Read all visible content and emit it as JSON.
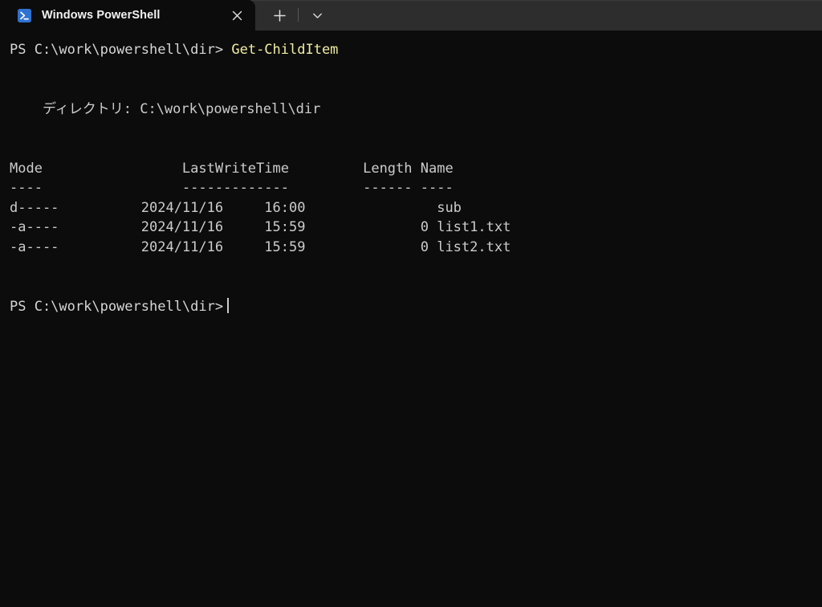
{
  "window": {
    "app_title": "Windows PowerShell",
    "colors": {
      "terminal_background": "#0c0c0c",
      "tabstrip_background": "#2d2d2d",
      "foreground": "#cccccc",
      "command_yellow": "#f0eda2",
      "icon_blue": "#2e72d2"
    }
  },
  "tabstrip": {
    "tabs": [
      {
        "label": "Windows PowerShell",
        "icon": "powershell-icon",
        "active": true,
        "close_icon": "close-icon"
      }
    ],
    "new_tab_icon": "plus-icon",
    "dropdown_icon": "chevron-down-icon"
  },
  "terminal": {
    "prompt": "PS C:\\work\\powershell\\dir>",
    "command": "Get-ChildItem",
    "directory_header": "    ディレクトリ: C:\\work\\powershell\\dir",
    "table": {
      "headers": [
        "Mode",
        "LastWriteTime",
        "Length",
        "Name"
      ],
      "rules": [
        "----",
        "-------------",
        "------",
        "----"
      ],
      "header_line": "Mode                 LastWriteTime         Length Name",
      "rule_line": "----                 -------------         ------ ----",
      "rows": [
        {
          "mode": "d-----",
          "date": "2024/11/16",
          "time": "16:00",
          "length": "",
          "name": "sub",
          "line": "d-----          2024/11/16     16:00                sub"
        },
        {
          "mode": "-a----",
          "date": "2024/11/16",
          "time": "15:59",
          "length": "0",
          "name": "list1.txt",
          "line": "-a----          2024/11/16     15:59              0 list1.txt"
        },
        {
          "mode": "-a----",
          "date": "2024/11/16",
          "time": "15:59",
          "length": "0",
          "name": "list2.txt",
          "line": "-a----          2024/11/16     15:59              0 list2.txt"
        }
      ]
    },
    "final_prompt": "PS C:\\work\\powershell\\dir>",
    "cursor_visible": true
  }
}
